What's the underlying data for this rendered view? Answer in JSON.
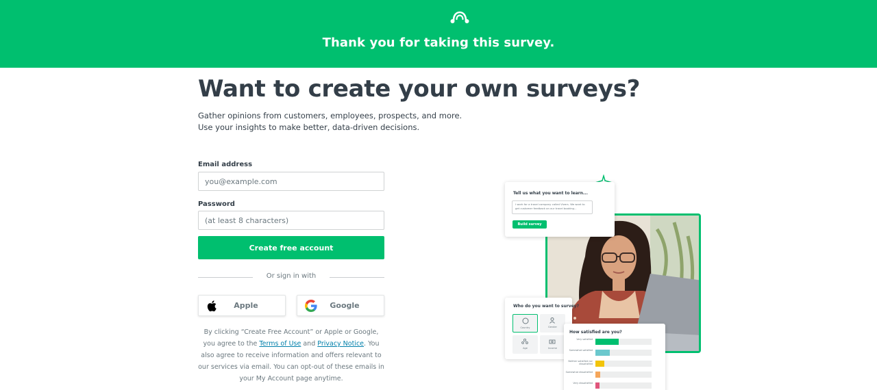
{
  "banner": {
    "title": "Thank you for taking this survey.",
    "logo_icon": "surveymonkey-logo-icon",
    "color": "#00bf6f"
  },
  "main": {
    "headline": "Want to create your own surveys?",
    "subtitle": "Gather opinions from customers, employees, prospects, and more. Use your insights to make better, data-driven decisions."
  },
  "form": {
    "email_label": "Email address",
    "email_placeholder": "you@example.com",
    "email_value": "",
    "password_label": "Password",
    "password_placeholder": "(at least 8 characters)",
    "password_value": "",
    "submit_label": "Create free account",
    "divider_text": "Or sign in with",
    "apple_label": "Apple",
    "google_label": "Google",
    "apple_icon": "apple-icon",
    "google_icon": "google-icon"
  },
  "legal": {
    "part1": "By clicking “Create Free Account” or Apple or Google, you agree to the ",
    "terms_link": "Terms of Use",
    "part2": " and ",
    "privacy_link": "Privacy Notice",
    "part3": ". You also agree to receive information and offers relevant to our services via email. You can opt-out of these emails in your My Account page anytime."
  },
  "illustration": {
    "card1": {
      "title": "Tell us what you want to learn...",
      "text": "I work for a travel company called Vivers. We want to get customer feedback on our travel booking...",
      "button": "Build survey"
    },
    "card2": {
      "title": "Who do you want to survey?",
      "options": [
        "Country",
        "Gender",
        "Age",
        "Income"
      ]
    },
    "card3": {
      "title": "How satisfied are you?",
      "rows": [
        {
          "label": "Very satisfied",
          "value": 0.42,
          "color": "#00bf6f"
        },
        {
          "label": "Somewhat satisfied",
          "value": 0.25,
          "color": "#6bc8cd"
        },
        {
          "label": "Neither satisfied nor dissatisfied",
          "value": 0.16,
          "color": "#f2c40a"
        },
        {
          "label": "Somewhat dissatisfied",
          "value": 0.08,
          "color": "#f5a65b"
        },
        {
          "label": "Very dissatisfied",
          "value": 0.07,
          "color": "#e0567c"
        }
      ]
    }
  }
}
